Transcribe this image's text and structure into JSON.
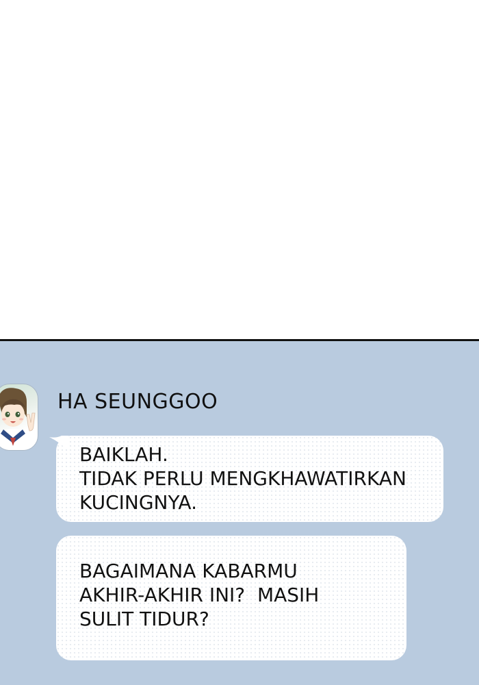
{
  "chat": {
    "sender_name": "HA SEUNGGOO",
    "messages": [
      {
        "lines": [
          "BAIKLAH.",
          "TIDAK PERLU MENGKHAWATIRKAN",
          "KUCINGNYA."
        ]
      },
      {
        "lines": [
          "BAGAIMANA KABARMU",
          "AKHIR-AKHIR INI?  MASIH",
          "SULIT TIDUR?"
        ]
      }
    ]
  },
  "colors": {
    "chat_background": "#b9cbdf",
    "bubble": "#ffffff",
    "text": "#111111",
    "divider": "#111111"
  },
  "icons": {
    "avatar": "profile-avatar-girl"
  }
}
